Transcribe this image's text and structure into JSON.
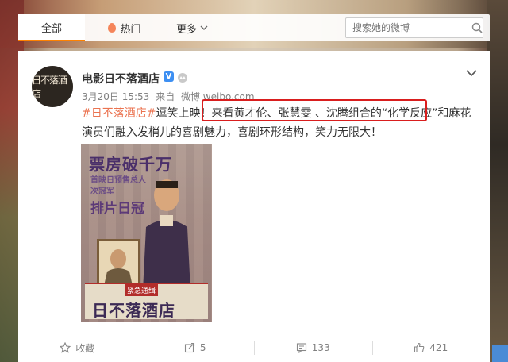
{
  "nav": {
    "tabs": [
      {
        "label": "全部",
        "active": true
      },
      {
        "label": "热门",
        "active": false
      },
      {
        "label": "更多",
        "active": false
      }
    ],
    "search_placeholder": "搜索她的微博"
  },
  "post": {
    "username": "电影日不落酒店",
    "avatar_text": "日不落酒店",
    "date": "3月20日 15:53",
    "source_prefix": "来自",
    "source": "微博 weibo.com",
    "hashtag": "#日不落酒店#",
    "text_1": "逗笑上映！",
    "text_highlight": "来看黄才伦、张慧雯 、沈腾组合的“化学反应”",
    "text_2": "和麻花演员们融入发梢儿的喜剧魅力，喜剧环形结构，笑力无限大！",
    "poster": {
      "headline": "票房破千万",
      "sub": "首映日预售总人次冠军",
      "pai": "排片日冠",
      "banner": "紧急通缉",
      "title_art": "日不落酒店"
    }
  },
  "actions": {
    "favorite": "收藏",
    "repost": "5",
    "comment": "133",
    "like": "421"
  },
  "colors": {
    "accent_orange": "#ff8200",
    "hashtag": "#eb7350",
    "highlight_box": "#d91e1e",
    "verified_blue": "#3d8ff2"
  }
}
